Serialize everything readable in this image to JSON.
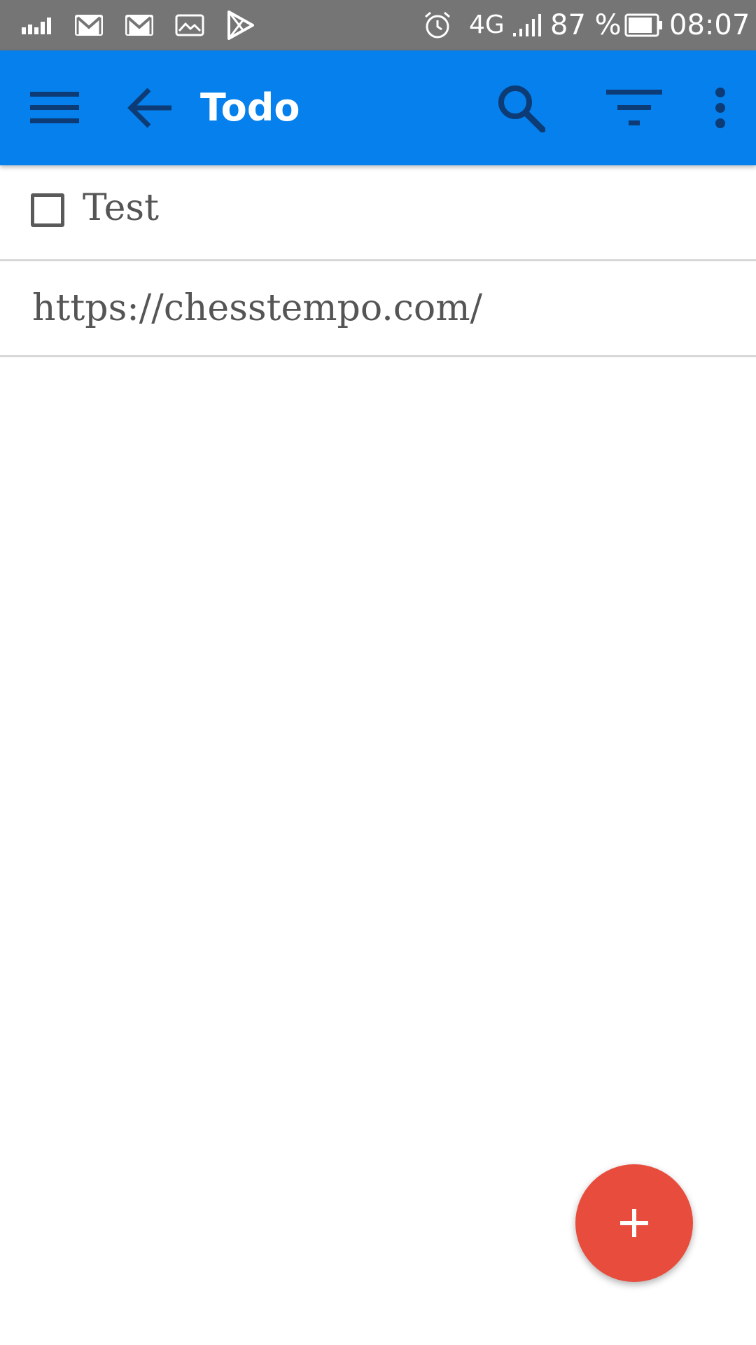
{
  "status_bar": {
    "network_type": "4G",
    "battery_percent": "87 %",
    "battery_level": 0.87,
    "time": "08:07",
    "left_icons": [
      "signal-bars-icon",
      "gmail-icon",
      "gmail-icon",
      "image-icon",
      "play-store-icon"
    ],
    "right_icons": [
      "alarm-icon",
      "network-4g-icon",
      "cell-signal-icon",
      "battery-icon"
    ]
  },
  "app_bar": {
    "title": "Todo",
    "background_color": "#0580ec",
    "icon_color": "#0d3b75",
    "icons": [
      "menu-icon",
      "back-arrow-icon",
      "search-icon",
      "filter-icon",
      "overflow-menu-icon"
    ]
  },
  "tasks": [
    {
      "text": "Test",
      "checked": false,
      "type": "task"
    },
    {
      "text": "https://chesstempo.com/",
      "type": "link"
    }
  ],
  "fab": {
    "icon": "plus-icon",
    "color": "#e84c3d"
  }
}
